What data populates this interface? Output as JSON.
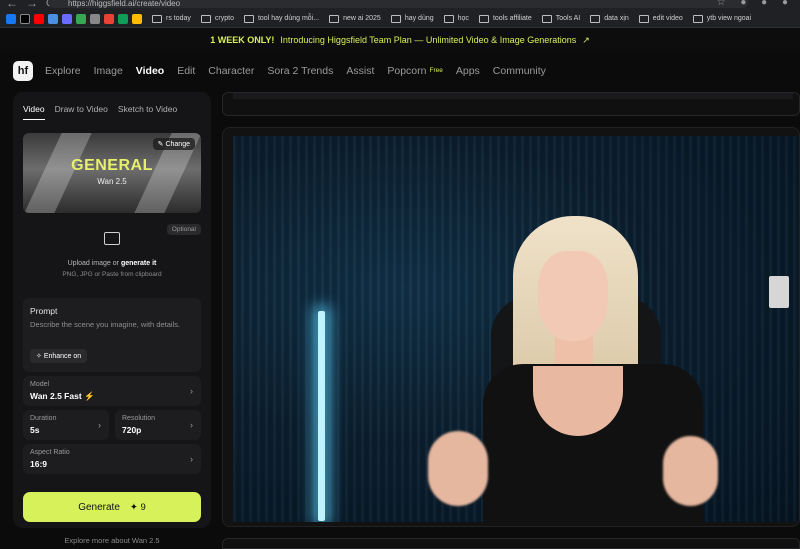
{
  "browser": {
    "url": "https://higgsfield.ai/create/video",
    "bookmarks": [
      "rs today",
      "crypto",
      "tool hay dùng mỗi...",
      "new ai 2025",
      "hay dùng",
      "học",
      "tools affiliate",
      "Tools AI",
      "data xịn",
      "edit video",
      "ytb view ngoai"
    ],
    "bookmark_icon_colors": [
      "#1877f2",
      "#ff0000",
      "#ff0000",
      "#4a90e2",
      "#6b6bff",
      "#ea4335",
      "#34a853",
      "#fbbc04",
      "#0f9d58",
      "#ffffff"
    ]
  },
  "banner": {
    "tag": "1 WEEK ONLY!",
    "text": "Introducing Higgsfield Team Plan — Unlimited Video & Image Generations",
    "arrow": "↗"
  },
  "nav": {
    "logo": "hf",
    "items": [
      "Explore",
      "Image",
      "Video",
      "Edit",
      "Character",
      "Sora 2 Trends",
      "Assist",
      "Popcorn",
      "Apps",
      "Community"
    ],
    "active": "Video",
    "popcorn_badge": "Free"
  },
  "panel": {
    "tabs": [
      "Video",
      "Draw to Video",
      "Sketch to Video"
    ],
    "preset": {
      "title": "GENERAL",
      "subtitle": "Wan 2.5",
      "change_label": "Change"
    },
    "upload": {
      "optional": "Optional",
      "text_prefix": "Upload image or",
      "text_link": "generate it",
      "hint": "PNG, JPG or Paste from clipboard"
    },
    "prompt": {
      "label": "Prompt",
      "placeholder": "Describe the scene you imagine, with details.",
      "enhance": "Enhance on"
    },
    "model": {
      "label": "Model",
      "value": "Wan 2.5 Fast"
    },
    "duration": {
      "label": "Duration",
      "value": "5s"
    },
    "resolution": {
      "label": "Resolution",
      "value": "720p"
    },
    "aspect_ratio": {
      "label": "Aspect Ratio",
      "value": "16:9"
    },
    "generate": {
      "label": "Generate",
      "cost": "9"
    },
    "explore_more": "Explore more about Wan 2.5"
  },
  "colors": {
    "accent": "#d7f15b",
    "background": "#0b0b0c",
    "panel": "#151517"
  }
}
